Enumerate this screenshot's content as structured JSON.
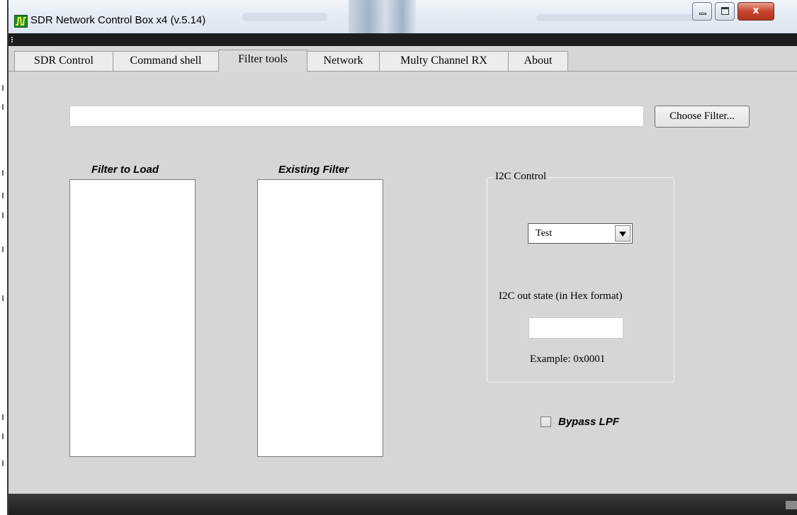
{
  "window": {
    "title": "SDR Network Control Box x4 (v.5.14)",
    "controls": {
      "minimize": "minimize",
      "maximize": "maximize",
      "close_glyph": "x"
    }
  },
  "tabs": [
    {
      "label": "SDR Control",
      "active": false
    },
    {
      "label": "Command shell",
      "active": false
    },
    {
      "label": "Filter tools",
      "active": true
    },
    {
      "label": "Network",
      "active": false
    },
    {
      "label": "Multy Channel RX",
      "active": false
    },
    {
      "label": "About",
      "active": false
    }
  ],
  "filter_tools": {
    "file_path_value": "",
    "choose_button_label": "Choose Filter...",
    "filter_to_load_title": "Filter to Load",
    "existing_filter_title": "Existing Filter",
    "i2c": {
      "group_title": "I2C Control",
      "combo_selected": "Test",
      "out_state_label": "I2C out state (in Hex format)",
      "hex_value": "",
      "example_text": "Example: 0x0001"
    },
    "bypass_lpf": {
      "label": "Bypass LPF",
      "checked": false
    }
  },
  "colors": {
    "title_bar": "#e5ecf4",
    "client_bg": "#d6d6d6",
    "close_button": "#c8442c",
    "app_icon": "#1f8a2a"
  }
}
